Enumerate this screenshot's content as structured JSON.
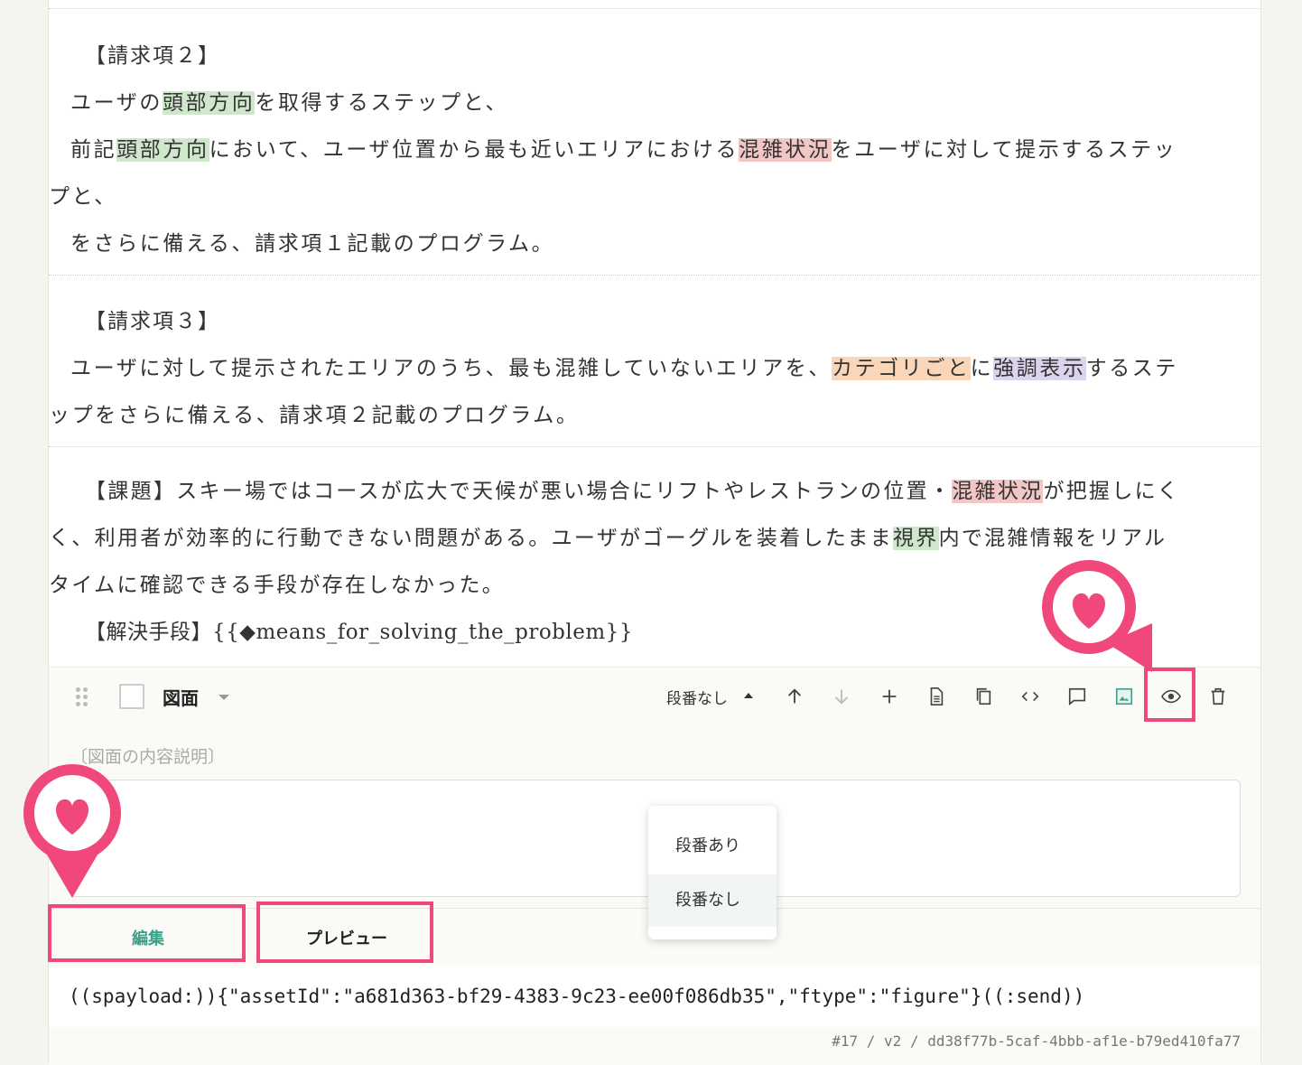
{
  "claims": [
    {
      "heading": "【請求項２】",
      "lines": [
        [
          {
            "t": "ユーザの"
          },
          {
            "t": "頭部方向",
            "hl": "green"
          },
          {
            "t": "を取得するステップと、"
          }
        ],
        [
          {
            "t": "前記"
          },
          {
            "t": "頭部方向",
            "hl": "green"
          },
          {
            "t": "において、ユーザ位置から最も近いエリアにおける"
          },
          {
            "t": "混雑状況",
            "hl": "red"
          },
          {
            "t": "をユーザに対して提示するステッ"
          }
        ],
        [
          {
            "t": "プと、",
            "cont": true
          }
        ],
        [
          {
            "t": "をさらに備える、請求項１記載のプログラム。"
          }
        ]
      ]
    },
    {
      "heading": "【請求項３】",
      "lines": [
        [
          {
            "t": "ユーザに対して提示されたエリアのうち、最も混雑していないエリアを、"
          },
          {
            "t": "カテゴリごと",
            "hl": "orange"
          },
          {
            "t": "に"
          },
          {
            "t": "強調表示",
            "hl": "purple"
          },
          {
            "t": "するステ"
          }
        ],
        [
          {
            "t": "ップをさらに備える、請求項２記載のプログラム。",
            "cont": true
          }
        ]
      ]
    },
    {
      "heading": "",
      "lines": [
        [
          {
            "t": "【課題】スキー場ではコースが広大で天候が悪い場合にリフトやレストランの位置・"
          },
          {
            "t": "混雑状況",
            "hl": "red"
          },
          {
            "t": "が把握しにく"
          }
        ],
        [
          {
            "t": "く、利用者が効率的に行動できない問題がある。ユーザがゴーグルを装着したまま",
            "cont": true
          },
          {
            "t": "視界",
            "hl": "green"
          },
          {
            "t": "内で混雑情報をリアル"
          }
        ],
        [
          {
            "t": "タイムに確認できる手段が存在しなかった。",
            "cont": true
          }
        ],
        [
          {
            "t": "【解決手段】{{◆means_for_solving_the_problem}}"
          }
        ]
      ]
    }
  ],
  "figure_block": {
    "type_label": "図面",
    "numbering_label": "段番なし",
    "desc_placeholder": "〔図面の内容説明〕",
    "tabs": {
      "edit": "編集",
      "preview": "プレビュー"
    },
    "payload": "((spayload:)){\"assetId\":\"a681d363-bf29-4383-9c23-ee00f086db35\",\"ftype\":\"figure\"}((:send))",
    "meta": "#17 / v2 / dd38f77b-5caf-4bbb-af1e-b79ed410fa77",
    "toolbar_icons": [
      "arrow-up-icon",
      "arrow-down-icon",
      "plus-icon",
      "document-icon",
      "copy-icon",
      "code-icon",
      "comment-icon",
      "image-icon",
      "eye-icon",
      "trash-icon"
    ]
  },
  "numbering_menu": {
    "items": [
      "段番あり",
      "段番なし"
    ],
    "selected": "段番なし"
  },
  "colors": {
    "highlight_green": "#cfe8cc",
    "highlight_red": "#f3c6c6",
    "highlight_orange": "#fad6b9",
    "highlight_purple": "#dcd3ec",
    "accent": "#3aa18a",
    "marker_pink": "#f0487a"
  }
}
